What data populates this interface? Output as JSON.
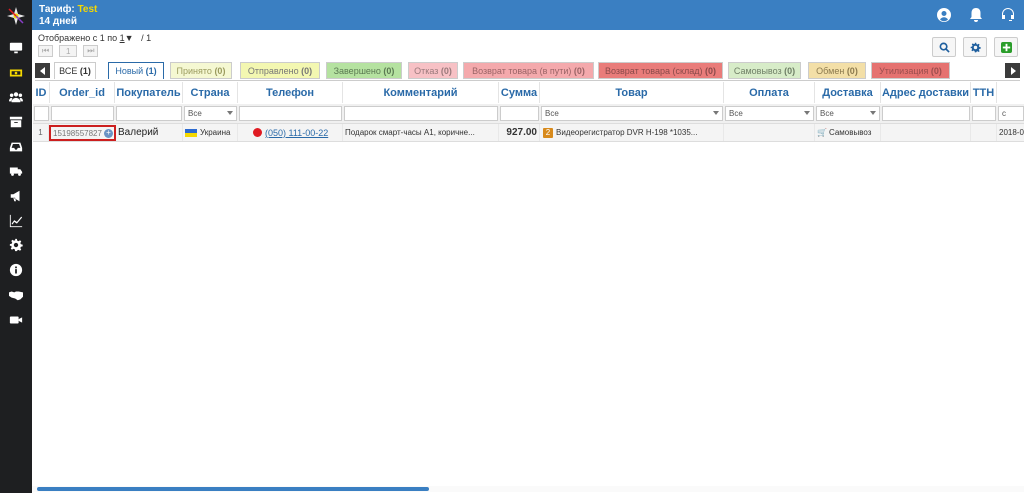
{
  "header": {
    "tariff_label": "Тариф:",
    "tariff_name": "Test",
    "days": "14 дней"
  },
  "sidebar": {
    "items": [
      {
        "icon": "monitor-icon"
      },
      {
        "icon": "money-icon"
      },
      {
        "icon": "users-icon"
      },
      {
        "icon": "archive-icon"
      },
      {
        "icon": "inbox-icon"
      },
      {
        "icon": "truck-icon"
      },
      {
        "icon": "megaphone-icon"
      },
      {
        "icon": "chart-icon"
      },
      {
        "icon": "gear-icon"
      },
      {
        "icon": "info-icon"
      },
      {
        "icon": "handshake-icon"
      },
      {
        "icon": "video-icon"
      }
    ]
  },
  "pager": {
    "shown_prefix": "Отображено с 1 по",
    "shown_value": "1",
    "total": "/ 1",
    "page": "1"
  },
  "tabs": [
    {
      "label": "ВСЕ",
      "count": "(1)"
    },
    {
      "label": "Новый",
      "count": "(1)"
    },
    {
      "label": "Принято",
      "count": "(0)"
    },
    {
      "label": "Отправлено",
      "count": "(0)"
    },
    {
      "label": "Завершено",
      "count": "(0)"
    },
    {
      "label": "Отказ",
      "count": "(0)"
    },
    {
      "label": "Возврат товара (в пути)",
      "count": "(0)"
    },
    {
      "label": "Возврат товара (склад)",
      "count": "(0)"
    },
    {
      "label": "Самовывоз",
      "count": "(0)"
    },
    {
      "label": "Обмен",
      "count": "(0)"
    },
    {
      "label": "Утилизация",
      "count": "(0)"
    }
  ],
  "columns": [
    "ID",
    "Order_id",
    "Покупатель",
    "Страна",
    "Телефон",
    "Комментарий",
    "Сумма",
    "Товар",
    "Оплата",
    "Доставка",
    "Адрес доставки",
    "ТТН"
  ],
  "filters": {
    "all": "Все",
    "date_prefix": "с"
  },
  "row": {
    "num": "1",
    "order_id": "15198557827",
    "buyer": "Валерий",
    "country": "Украина",
    "phone": "(050) 111-00-22",
    "comment": "Подарок смарт-часы А1, коричне...",
    "sum": "927.00",
    "product_qty": "2",
    "product": "Видеорегистратор DVR H-198 *1035...",
    "delivery": "Самовывоз",
    "date": "2018-0"
  }
}
